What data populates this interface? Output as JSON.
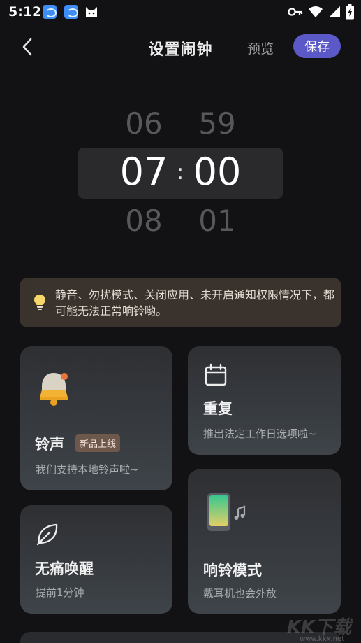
{
  "status_bar": {
    "time": "5:12",
    "left_icons": [
      "app-icon",
      "app-icon",
      "cat-icon"
    ],
    "right_icons": [
      "key-icon",
      "wifi-icon",
      "signal-icon",
      "battery-icon"
    ]
  },
  "header": {
    "title": "设置闹钟",
    "preview_label": "预览",
    "save_label": "保存"
  },
  "time_picker": {
    "hour_prev": "06",
    "hour": "07",
    "hour_next": "08",
    "minute_prev": "59",
    "minute": "00",
    "minute_next": "01",
    "separator": ":"
  },
  "tip": {
    "text": "静音、勿扰模式、关闭应用、未开启通知权限情况下，都可能无法正常响铃哟。",
    "icon": "lightbulb-icon"
  },
  "cards": {
    "ringtone": {
      "title": "铃声",
      "badge": "新品上线",
      "subtitle": "我们支持本地铃声啦~",
      "icon": "bell-icon"
    },
    "repeat": {
      "title": "重复",
      "subtitle": "推出法定工作日选项啦~",
      "icon": "calendar-icon"
    },
    "gentle_wake": {
      "title": "无痛唤醒",
      "subtitle": "提前1分钟",
      "icon": "leaf-icon"
    },
    "ring_mode": {
      "title": "响铃模式",
      "subtitle": "戴耳机也会外放",
      "icon": "phone-music-icon"
    }
  },
  "watermark": {
    "text": "KK下载",
    "url": "www.kkx.net"
  },
  "colors": {
    "background": "#121113",
    "accent": "#5b58c7",
    "tip_background": "#3a332d",
    "badge_background": "#6e574b"
  }
}
